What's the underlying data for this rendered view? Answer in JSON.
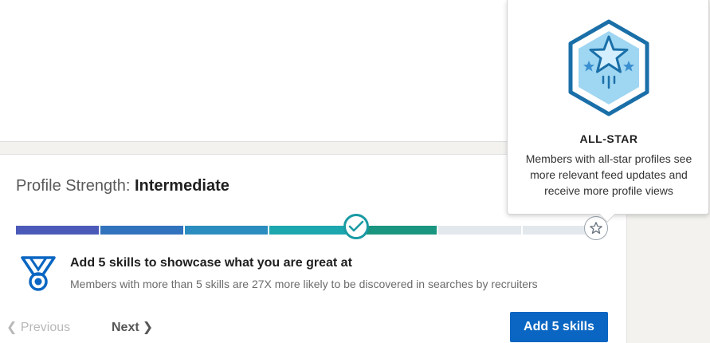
{
  "profile_strength": {
    "label": "Profile Strength: ",
    "level": "Intermediate",
    "progress_fraction": 0.575
  },
  "meter": {
    "segment_colors": [
      "#4b5ab8",
      "#3273bd",
      "#2b8dbf",
      "#1ca6ae",
      "#1a9580",
      "#e3e8ed",
      "#e3e8ed"
    ],
    "filled_segments": 5,
    "total_segments": 7,
    "current_marker_icon": "check-icon",
    "goal_marker_icon": "star-icon"
  },
  "task": {
    "icon": "medal-icon",
    "title": "Add 5 skills to showcase what you are great at",
    "description": "Members with more than 5 skills are 27X more likely to be discovered in searches by recruiters"
  },
  "navigation": {
    "previous_label": "Previous",
    "next_label": "Next",
    "next_chevron": "❯"
  },
  "action": {
    "button_label": "Add 5 skills"
  },
  "tooltip": {
    "badge_icon": "all-star-badge-icon",
    "title": "ALL-STAR",
    "description": "Members with all-star profiles see more relevant feed updates and receive more profile views"
  },
  "colors": {
    "accent": "#0a66c2",
    "teal": "#1a9aa3",
    "badge_blue": "#1a6fa8",
    "badge_light": "#9fd6f2"
  }
}
